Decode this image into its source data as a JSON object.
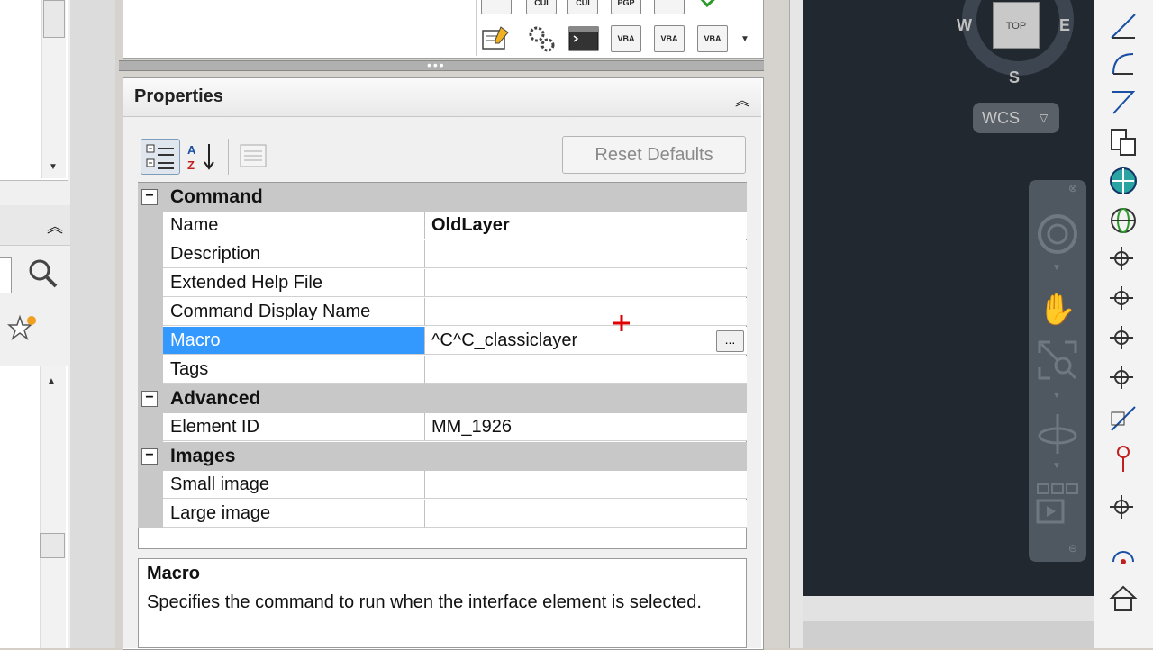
{
  "properties_panel": {
    "title": "Properties",
    "reset_defaults_label": "Reset Defaults",
    "categories": [
      {
        "label": "Command",
        "toggle": "⊟"
      },
      {
        "label": "Advanced",
        "toggle": "⊟"
      },
      {
        "label": "Images",
        "toggle": "⊟"
      }
    ],
    "rows": {
      "name": {
        "name": "Name",
        "value": "OldLayer"
      },
      "description": {
        "name": "Description",
        "value": ""
      },
      "help_file": {
        "name": "Extended Help File",
        "value": ""
      },
      "display_name": {
        "name": "Command Display Name",
        "value": ""
      },
      "macro": {
        "name": "Macro",
        "value": "^C^C_classiclayer"
      },
      "tags": {
        "name": "Tags",
        "value": ""
      },
      "element_id": {
        "name": "Element ID",
        "value": "MM_1926"
      },
      "small_image": {
        "name": "Small image",
        "value": ""
      },
      "large_image": {
        "name": "Large image",
        "value": ""
      }
    },
    "ellipsis_label": "...",
    "description_box": {
      "title": "Macro",
      "text": "Specifies the command to run when the interface element is selected."
    }
  },
  "toolbar_icons": {
    "top": [
      "",
      "CUI",
      "CUI",
      "PGP",
      "",
      ""
    ],
    "bottom": [
      "",
      "",
      "",
      "VBA",
      "VBA",
      "VBA"
    ]
  },
  "viewcube": {
    "face": "TOP",
    "west": "W",
    "east": "E",
    "south": "S",
    "wcs_label": "WCS"
  },
  "colors": {
    "selection": "#3399ff",
    "canvas": "#212830",
    "category_bg": "#c8c8c8",
    "cursor": "#e00000"
  }
}
